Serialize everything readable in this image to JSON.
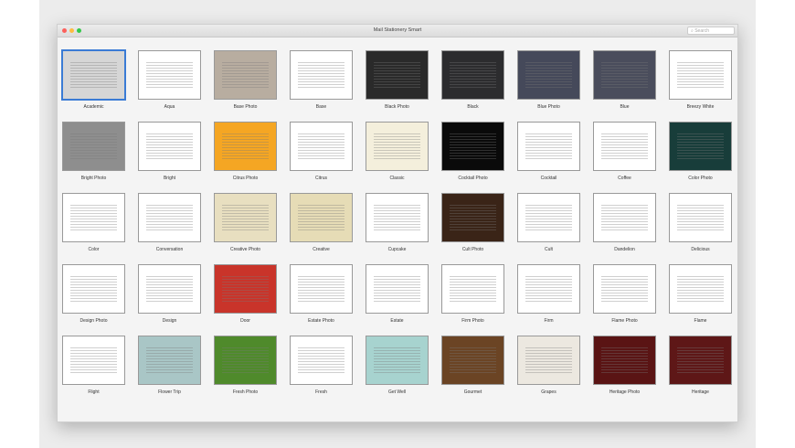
{
  "window": {
    "title": "Mail Stationery Smart",
    "search_placeholder": "Search",
    "traffic_lights": [
      "#fc605c",
      "#fdbc40",
      "#34c84a"
    ]
  },
  "templates": [
    {
      "label": "Academic",
      "bg": "#d6d6d6",
      "selected": true
    },
    {
      "label": "Aqua",
      "bg": "#ffffff"
    },
    {
      "label": "Base Photo",
      "bg": "#b8ada0"
    },
    {
      "label": "Base",
      "bg": "#ffffff"
    },
    {
      "label": "Black Photo",
      "bg": "#2a2a2a"
    },
    {
      "label": "Black",
      "bg": "#2c2c2e"
    },
    {
      "label": "Blue Photo",
      "bg": "#45495a"
    },
    {
      "label": "Blue",
      "bg": "#4a4d5c"
    },
    {
      "label": "Breezy White",
      "bg": "#ffffff"
    },
    {
      "label": "Bright Photo",
      "bg": "#8e8e8e"
    },
    {
      "label": "Bright",
      "bg": "#ffffff"
    },
    {
      "label": "Citrus Photo",
      "bg": "#f5a623"
    },
    {
      "label": "Citrus",
      "bg": "#ffffff"
    },
    {
      "label": "Classic",
      "bg": "#f4efdc"
    },
    {
      "label": "Cocktail Photo",
      "bg": "#0a0a0a"
    },
    {
      "label": "Cocktail",
      "bg": "#ffffff"
    },
    {
      "label": "Coffee",
      "bg": "#ffffff"
    },
    {
      "label": "Color Photo",
      "bg": "#183d3a"
    },
    {
      "label": "Color",
      "bg": "#ffffff"
    },
    {
      "label": "Conversation",
      "bg": "#ffffff"
    },
    {
      "label": "Creative Photo",
      "bg": "#e8dfc0"
    },
    {
      "label": "Creative",
      "bg": "#e6dcb6"
    },
    {
      "label": "Cupcake",
      "bg": "#ffffff"
    },
    {
      "label": "Cult Photo",
      "bg": "#3a2417"
    },
    {
      "label": "Cult",
      "bg": "#ffffff"
    },
    {
      "label": "Dandelion",
      "bg": "#ffffff"
    },
    {
      "label": "Delicious",
      "bg": "#ffffff"
    },
    {
      "label": "Design Photo",
      "bg": "#ffffff"
    },
    {
      "label": "Design",
      "bg": "#ffffff"
    },
    {
      "label": "Door",
      "bg": "#c9342a"
    },
    {
      "label": "Estate Photo",
      "bg": "#ffffff"
    },
    {
      "label": "Estate",
      "bg": "#ffffff"
    },
    {
      "label": "Firm Photo",
      "bg": "#ffffff"
    },
    {
      "label": "Firm",
      "bg": "#ffffff"
    },
    {
      "label": "Flame Photo",
      "bg": "#ffffff"
    },
    {
      "label": "Flame",
      "bg": "#ffffff"
    },
    {
      "label": "Flight",
      "bg": "#ffffff"
    },
    {
      "label": "Flower Trip",
      "bg": "#a9c6c6"
    },
    {
      "label": "Fresh Photo",
      "bg": "#4f8a2b"
    },
    {
      "label": "Fresh",
      "bg": "#ffffff"
    },
    {
      "label": "Get Well",
      "bg": "#a7d3cf"
    },
    {
      "label": "Gourmet",
      "bg": "#6b4424"
    },
    {
      "label": "Grapes",
      "bg": "#ece8e0"
    },
    {
      "label": "Heritage Photo",
      "bg": "#5a1414"
    },
    {
      "label": "Heritage",
      "bg": "#5e1717"
    }
  ]
}
